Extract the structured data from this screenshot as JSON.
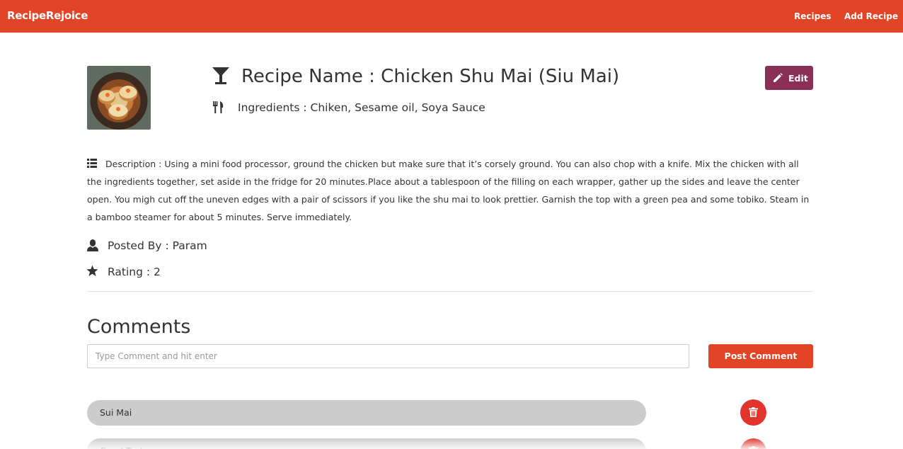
{
  "navbar": {
    "brand": "RecipeRejoice",
    "links": [
      "Recipes",
      "Add Recipe"
    ],
    "color": "#e24526"
  },
  "recipe": {
    "title": "Recipe Name : Chicken Shu Mai (Siu Mai)",
    "ingredients": "Ingredients : Chiken, Sesame oil, Soya Sauce",
    "edit_label": "Edit",
    "description": "Description : Using a mini food processor, ground the chicken but make sure that it’s corsely ground. You can also chop with a knife. Mix the chicken with all the ingredients together, set aside in the fridge for 20 minutes.Place about a tablespoon of the filling on each wrapper, gather up the sides and leave the center open. You migh cut off the uneven edges with a pair of scissors if you like the shu mai to look prettier. Garnish the top with a green pea and some tobiko. Steam in a bamboo steamer for about 5 minutes. Serve immediately.",
    "posted_by": "Posted By : Param",
    "rating": "Rating : 2",
    "icons": {
      "title": "cocktail-glass-icon",
      "ingredients": "cutlery-icon",
      "description": "list-icon",
      "posted_by": "user-icon",
      "rating": "star-icon",
      "edit": "pencil-icon"
    },
    "edit_color": "#8a2f55"
  },
  "comments": {
    "heading": "Comments",
    "input_placeholder": "Type Comment and hit enter",
    "input_value": "",
    "post_label": "Post Comment",
    "items": [
      {
        "text": "Sui Mai"
      },
      {
        "text": "Good Taste"
      }
    ],
    "delete_icon": "trash-icon",
    "delete_color": "#e2342c"
  }
}
